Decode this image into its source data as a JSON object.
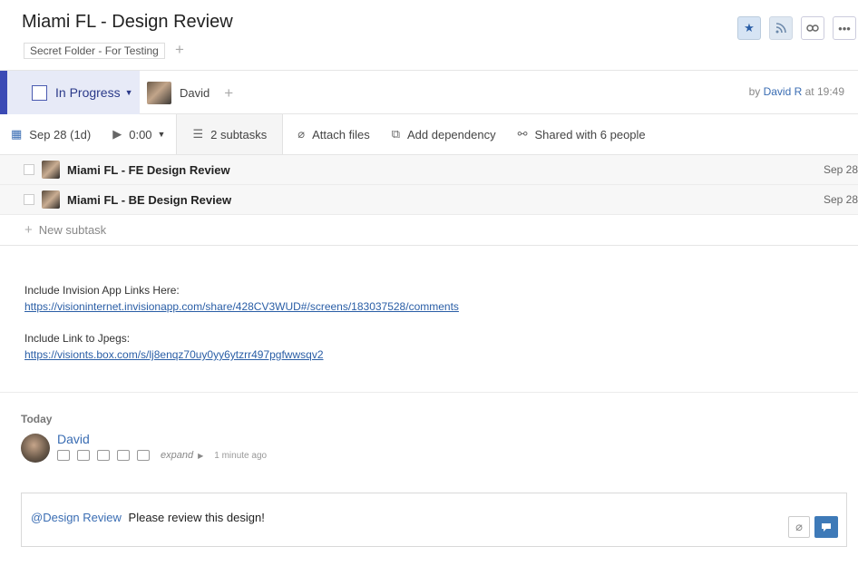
{
  "task": {
    "title": "Miami FL - Design Review",
    "folder": "Secret Folder - For Testing"
  },
  "status": {
    "label": "In Progress",
    "assignee": "David",
    "by_prefix": "by",
    "author": "David R",
    "time_text": "at 19:49"
  },
  "toolbar": {
    "date": "Sep 28 (1d)",
    "timer": "0:00",
    "subtasks": "2 subtasks",
    "attach": "Attach files",
    "dependency": "Add dependency",
    "shared": "Shared with 6 people"
  },
  "subtasks": [
    {
      "name": "Miami FL - FE Design Review",
      "date": "Sep 28"
    },
    {
      "name": "Miami FL - BE Design Review",
      "date": "Sep 28"
    }
  ],
  "new_subtask_label": "New subtask",
  "description": {
    "line1": "Include Invision App Links Here:",
    "link1": "https://visioninternet.invisionapp.com/share/428CV3WUD#/screens/183037528/comments",
    "line2": "Include Link to Jpegs:",
    "link2": "https://visionts.box.com/s/lj8enqz70uy0yy6ytzrr497pgfwwsqv2"
  },
  "stream": {
    "day": "Today",
    "author": "David",
    "expand": "expand",
    "time": "1 minute ago"
  },
  "composer": {
    "mention": "@Design Review",
    "text": "Please review this design!"
  },
  "icons": {
    "star": "star-icon",
    "rss": "rss-icon",
    "link": "link-icon",
    "more": "more-icon",
    "calendar": "calendar-icon",
    "play": "play-icon",
    "list": "list-icon",
    "paperclip": "paperclip-icon",
    "dependency": "dependency-icon",
    "share": "share-icon",
    "send": "send-icon"
  },
  "colors": {
    "accent": "#3b4ab5",
    "status_bg": "#e7eaf7",
    "link": "#2a5ea6",
    "send": "#3e7ab8"
  }
}
